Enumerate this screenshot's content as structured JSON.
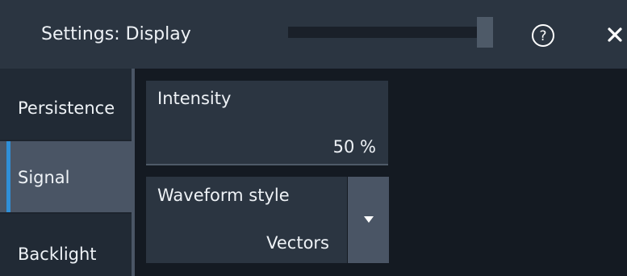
{
  "dialog": {
    "title": "Settings: Display",
    "icons": {
      "help": "help-circle-icon",
      "close": "close-icon"
    }
  },
  "sidebar": {
    "items": [
      {
        "label": "Persistence",
        "selected": false
      },
      {
        "label": "Signal",
        "selected": true
      },
      {
        "label": "Backlight",
        "selected": false
      }
    ]
  },
  "intensity": {
    "label": "Intensity",
    "value": "50 %"
  },
  "waveform_style": {
    "label": "Waveform style",
    "value": "Vectors",
    "dropdown_icon": "caret-down-icon"
  },
  "colors": {
    "accent": "#2f8fd8",
    "header_bg": "#2b3541",
    "selected_tab_bg": "#4a5565"
  }
}
